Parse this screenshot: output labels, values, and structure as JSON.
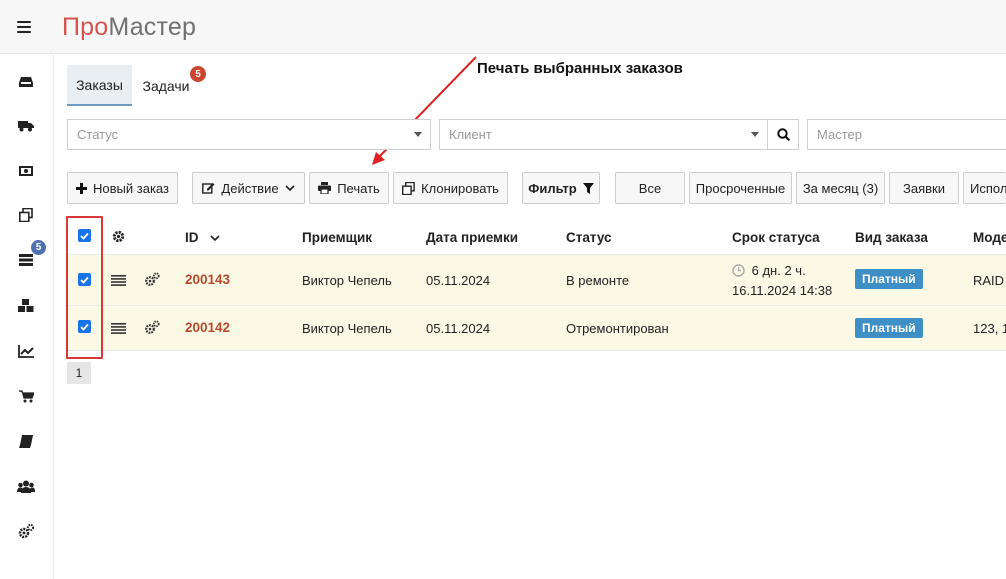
{
  "brand": {
    "part1": "Про",
    "part2": "Мастер"
  },
  "sidebar": {
    "items": [
      {
        "name": "inbox-icon"
      },
      {
        "name": "truck-icon"
      },
      {
        "name": "money-icon"
      },
      {
        "name": "clone-icon"
      },
      {
        "name": "list-icon"
      },
      {
        "name": "cubes-icon"
      },
      {
        "name": "chart-icon"
      },
      {
        "name": "cart-icon"
      },
      {
        "name": "book-icon"
      },
      {
        "name": "users-icon"
      },
      {
        "name": "cogs-icon"
      }
    ],
    "badge": "5"
  },
  "tabs": [
    {
      "label": "Заказы",
      "active": true
    },
    {
      "label": "Задачи",
      "badge": "5"
    }
  ],
  "annotation": {
    "text": "Печать выбранных заказов",
    "color": "#e02020"
  },
  "filters": {
    "status_placeholder": "Статус",
    "client_placeholder": "Клиент",
    "master_placeholder": "Мастер"
  },
  "toolbar": {
    "new_order": "Новый заказ",
    "action": "Действие",
    "print": "Печать",
    "clone": "Клонировать",
    "filter": "Фильтр",
    "all": "Все",
    "overdue": "Просроченные",
    "month": "За месяц (3)",
    "requests": "Заявки",
    "performer": "Испол"
  },
  "table": {
    "columns": {
      "id": "ID",
      "receiver": "Приемщик",
      "date": "Дата приемки",
      "status": "Статус",
      "deadline": "Срок статуса",
      "type": "Вид заказа",
      "model": "Моде"
    },
    "rows": [
      {
        "checked": true,
        "id": "200143",
        "receiver": "Виктор Чепель",
        "date": "05.11.2024",
        "status": "В ремонте",
        "deadline_left": "6 дн. 2 ч.",
        "deadline_date": "16.11.2024 14:38",
        "type": "Платный",
        "model": "RAID"
      },
      {
        "checked": true,
        "id": "200142",
        "receiver": "Виктор Чепель",
        "date": "05.11.2024",
        "status": "Отремонтирован",
        "deadline_left": "",
        "deadline_date": "",
        "type": "Платный",
        "model": "123, 1"
      }
    ]
  },
  "pagination": {
    "current": "1"
  },
  "colors": {
    "accent": "#3d8fc6",
    "link": "#b44a2d",
    "row_bg": "#fcf8e6",
    "highlight": "#d93838"
  }
}
